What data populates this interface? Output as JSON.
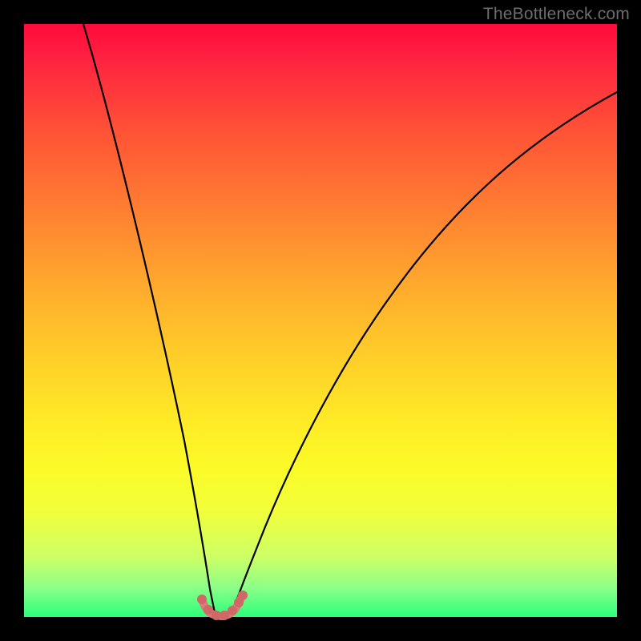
{
  "watermark": "TheBottleneck.com",
  "chart_data": {
    "type": "line",
    "title": "",
    "xlabel": "",
    "ylabel": "",
    "xlim": [
      0,
      100
    ],
    "ylim": [
      0,
      100
    ],
    "grid": false,
    "legend": false,
    "notes": "Bottleneck-style asymmetric V curve on rainbow gradient. No axis ticks or numeric labels are rendered; values are approximate from geometry.",
    "series": [
      {
        "name": "left-branch",
        "x": [
          10,
          15,
          20,
          24,
          27,
          29,
          30,
          31
        ],
        "y": [
          100,
          78,
          55,
          34,
          16,
          5,
          1,
          0
        ]
      },
      {
        "name": "right-branch",
        "x": [
          34,
          36,
          40,
          46,
          54,
          64,
          76,
          90,
          100
        ],
        "y": [
          0,
          3,
          12,
          28,
          45,
          60,
          73,
          83,
          89
        ]
      }
    ],
    "highlight": {
      "name": "bottom-u-marker",
      "x": [
        29,
        30,
        31,
        32,
        33,
        34,
        35
      ],
      "y": [
        3.2,
        1.2,
        0.4,
        0.2,
        0.4,
        1.0,
        2.6
      ],
      "color": "#d97c7c"
    },
    "background_gradient": [
      {
        "stop": 0.0,
        "color": "#ff0a3b"
      },
      {
        "stop": 0.3,
        "color": "#ff7a32"
      },
      {
        "stop": 0.55,
        "color": "#ffc82a"
      },
      {
        "stop": 0.78,
        "color": "#fbfb28"
      },
      {
        "stop": 0.92,
        "color": "#a6ff72"
      },
      {
        "stop": 1.0,
        "color": "#2bff7a"
      }
    ]
  }
}
